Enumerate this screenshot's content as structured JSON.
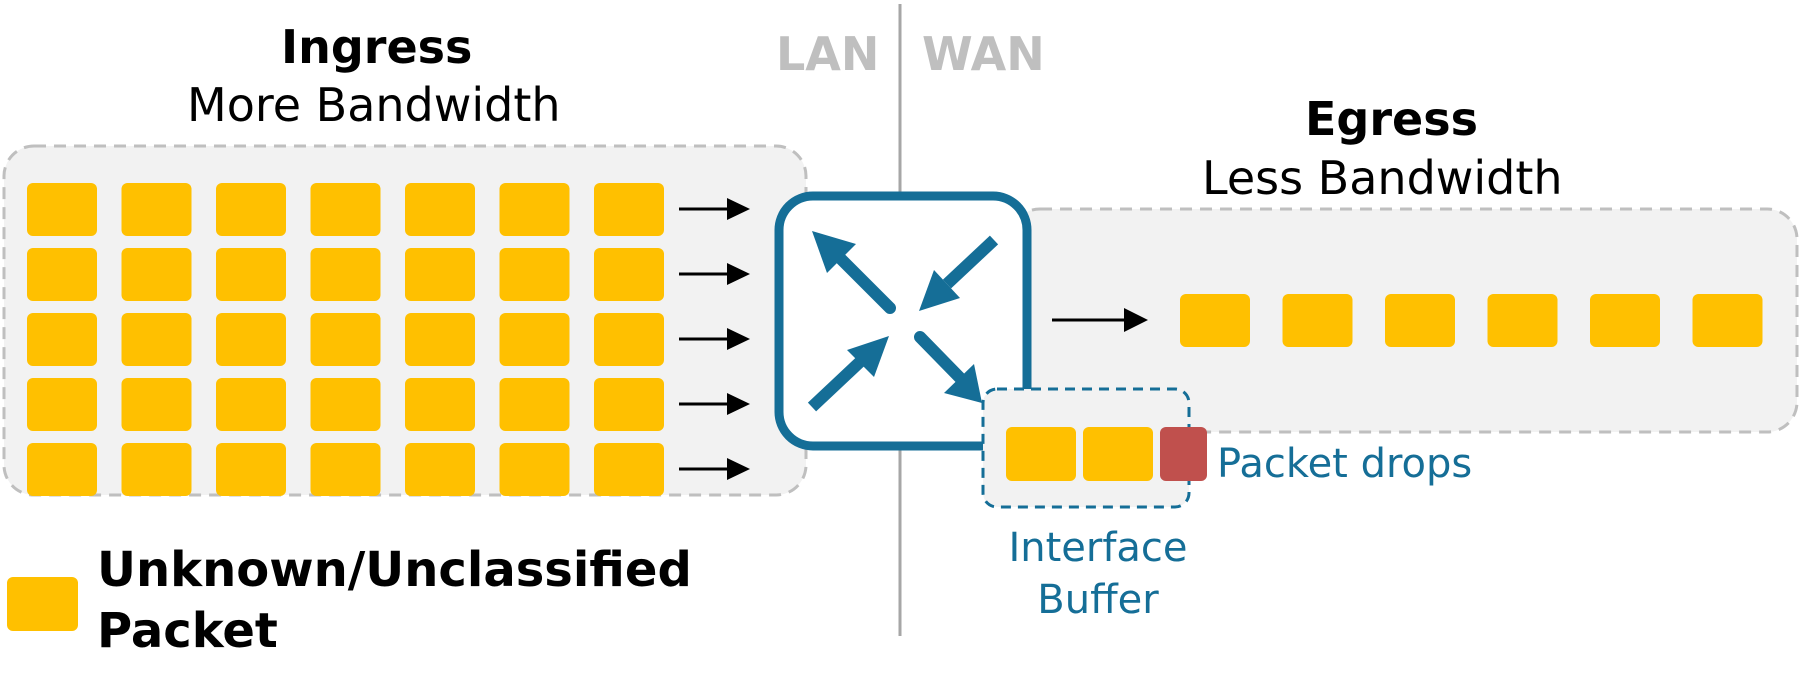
{
  "zones": {
    "left_label": "LAN",
    "right_label": "WAN"
  },
  "ingress": {
    "title": "Ingress",
    "subtitle": "More Bandwidth",
    "packet_rows": 5,
    "packets_per_row": 7
  },
  "egress": {
    "title": "Egress",
    "subtitle": "Less Bandwidth",
    "packet_count": 6
  },
  "router": {
    "icon": "router-switch-icon"
  },
  "buffer": {
    "label_line1": "Interface",
    "label_line2": "Buffer",
    "queued_packets": 2,
    "dropped_packets": 1,
    "drop_label": "Packet drops"
  },
  "legend": {
    "line1": "Unknown/Unclassified",
    "line2": "Packet"
  },
  "colors": {
    "packet": "#FFC000",
    "dropped_packet": "#C0504D",
    "router": "#156E97",
    "zone_fill": "#F2F2F2",
    "zone_border": "#BFBFBF",
    "divider": "#A6A6A6",
    "arrow": "#000000"
  }
}
